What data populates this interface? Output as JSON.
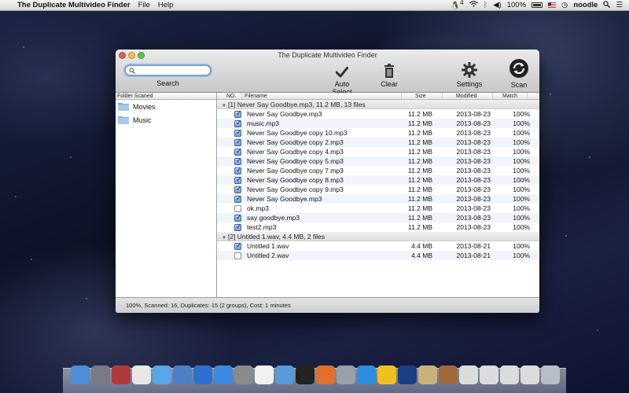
{
  "menubar": {
    "app_name": "The Duplicate Multivideo Finder",
    "menus": [
      "File",
      "Help"
    ],
    "notification_count": "4",
    "battery": "100%",
    "user": "noodle"
  },
  "window": {
    "title": "The Duplicate Multivideo Finder",
    "search": {
      "value": "",
      "label": "Search"
    },
    "toolbar": {
      "auto_select": "Auto Select",
      "clear": "Clear",
      "settings": "Settings",
      "scan": "Scan"
    },
    "sidebar": {
      "header": "Folder Scaned",
      "folders": [
        "Movies",
        "Music"
      ]
    },
    "table": {
      "columns": [
        "NO.",
        "Filename",
        "Size",
        "Modified",
        "Match"
      ],
      "groups": [
        {
          "label": "[1] Never Say Goodbye.mp3, 11.2 MB, 13 files",
          "files": [
            {
              "checked": true,
              "name": "Never Say Goodbye.mp3",
              "size": "11.2 MB",
              "modified": "2013-08-23",
              "match": "100%"
            },
            {
              "checked": true,
              "name": "music.mp3",
              "size": "11.2 MB",
              "modified": "2013-08-23",
              "match": "100%"
            },
            {
              "checked": true,
              "name": "Never Say Goodbye copy 10.mp3",
              "size": "11.2 MB",
              "modified": "2013-08-23",
              "match": "100%"
            },
            {
              "checked": true,
              "name": "Never Say Goodbye copy 2.mp3",
              "size": "11.2 MB",
              "modified": "2013-08-23",
              "match": "100%"
            },
            {
              "checked": true,
              "name": "Never Say Goodbye copy 4.mp3",
              "size": "11.2 MB",
              "modified": "2013-08-23",
              "match": "100%"
            },
            {
              "checked": true,
              "name": "Never Say Goodbye copy 5.mp3",
              "size": "11.2 MB",
              "modified": "2013-08-23",
              "match": "100%"
            },
            {
              "checked": true,
              "name": "Never Say Goodbye copy 7.mp3",
              "size": "11.2 MB",
              "modified": "2013-08-23",
              "match": "100%"
            },
            {
              "checked": true,
              "name": "Never Say Goodbye copy 8.mp3",
              "size": "11.2 MB",
              "modified": "2013-08-23",
              "match": "100%"
            },
            {
              "checked": true,
              "name": "Never Say Goodbye copy 9.mp3",
              "size": "11.2 MB",
              "modified": "2013-08-23",
              "match": "100%"
            },
            {
              "checked": true,
              "name": "Never Say Goodbye.mp3",
              "size": "11.2 MB",
              "modified": "2013-08-23",
              "match": "100%"
            },
            {
              "checked": false,
              "name": "ok.mp3",
              "size": "11.2 MB",
              "modified": "2013-08-23",
              "match": "100%"
            },
            {
              "checked": true,
              "name": "say goodbye.mp3",
              "size": "11.2 MB",
              "modified": "2013-08-23",
              "match": "100%"
            },
            {
              "checked": true,
              "name": "test2.mp3",
              "size": "11.2 MB",
              "modified": "2013-08-23",
              "match": "100%"
            }
          ]
        },
        {
          "label": "[2] Untitled 1.wav, 4.4 MB, 2 files",
          "files": [
            {
              "checked": true,
              "name": "Untitled 1.wav",
              "size": "4.4 MB",
              "modified": "2013-08-21",
              "match": "100%"
            },
            {
              "checked": false,
              "name": "Untitled 2.wav",
              "size": "4.4 MB",
              "modified": "2013-08-21",
              "match": "100%"
            }
          ]
        }
      ]
    },
    "status": "100%, Scanned: 16, Duplicates: 15 (2 groups), Cost: 1 minutes"
  },
  "dock": {
    "icons": [
      "finder-icon",
      "launchpad-icon",
      "photo-booth-icon",
      "calendar-icon",
      "activity-icon",
      "preview-icon",
      "itunes-icon",
      "app-store-icon",
      "system-preferences-icon",
      "textedit-icon",
      "mail-icon",
      "terminal-icon",
      "firefox-icon",
      "disk-utility-icon",
      "safari-icon",
      "qq-icon",
      "photoshop-icon",
      "scripts-icon",
      "utilities-icon",
      "finder-window-icon",
      "finder-window-icon",
      "finder-window-icon",
      "finder-window-icon",
      "trash-icon"
    ],
    "colors": [
      "#4a8fd8",
      "#7a7a86",
      "#b03a3a",
      "#e8e8e8",
      "#58a5e8",
      "#4d7fc4",
      "#2f6fd0",
      "#3a8ae0",
      "#8a8a8a",
      "#f0f0f0",
      "#5a9ad8",
      "#222222",
      "#e2702a",
      "#9aa0a8",
      "#2f8de0",
      "#f0c020",
      "#1b3f86",
      "#c8b27a",
      "#a06a3a",
      "#dcdcdc",
      "#dcdcdc",
      "#dcdcdc",
      "#dcdcdc",
      "#b8bec8"
    ]
  }
}
